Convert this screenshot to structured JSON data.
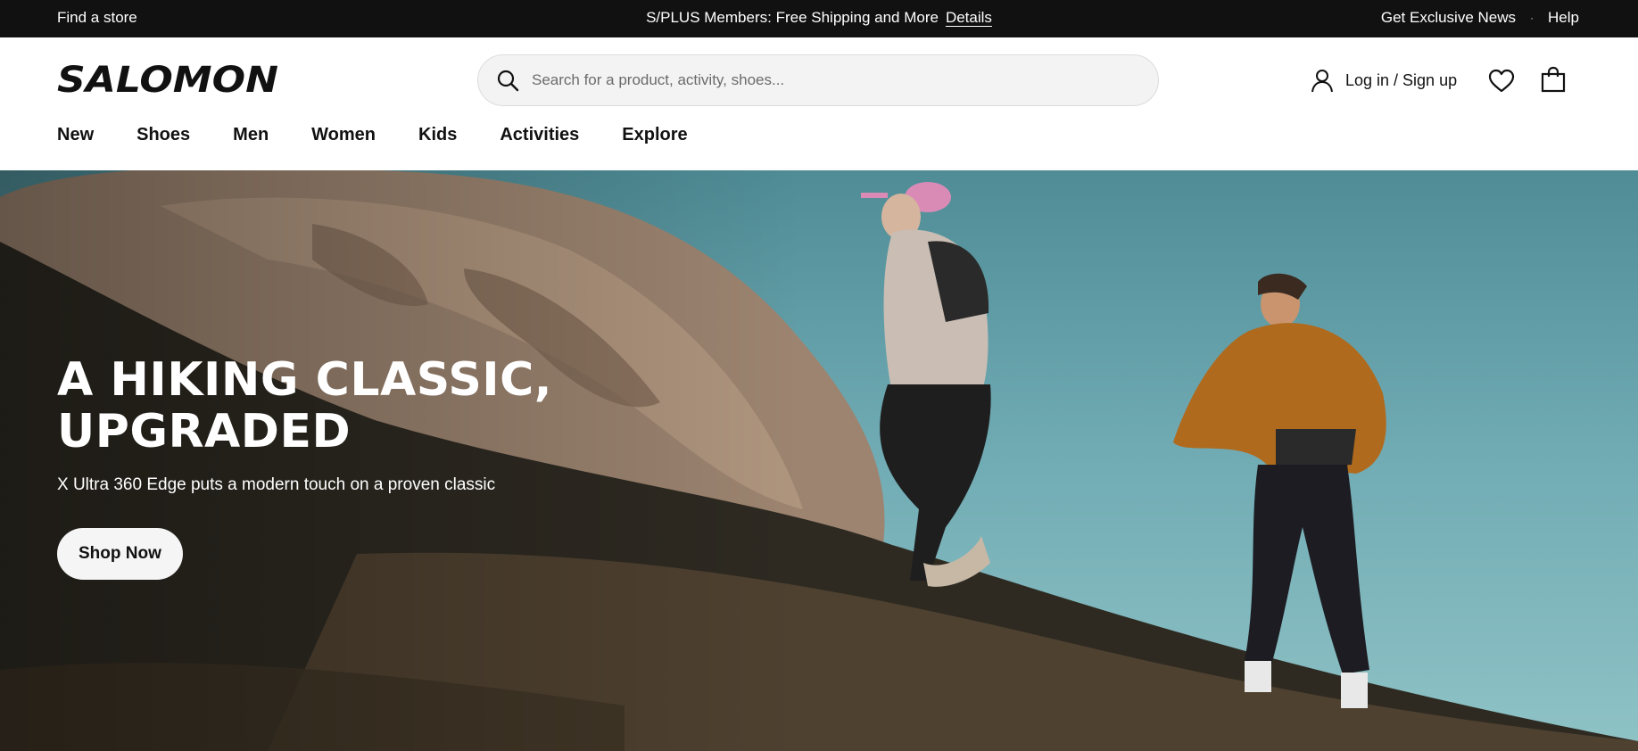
{
  "topbar": {
    "find_store": "Find a store",
    "promo_text": "S/PLUS Members: Free Shipping and More",
    "promo_link": "Details",
    "exclusive_news": "Get Exclusive News",
    "separator": "·",
    "help": "Help"
  },
  "header": {
    "logo_text": "SALOMON",
    "search_placeholder": "Search for a product, activity, shoes...",
    "account_label": "Log in / Sign up",
    "icons": [
      "search-icon",
      "user-icon",
      "heart-icon",
      "bag-icon"
    ]
  },
  "nav": {
    "items": [
      "New",
      "Shoes",
      "Men",
      "Women",
      "Kids",
      "Activities",
      "Explore"
    ]
  },
  "hero": {
    "title_line1": "A HIKING CLASSIC,",
    "title_line2": "UPGRADED",
    "subtitle": "X Ultra 360 Edge puts a modern touch on a proven classic",
    "cta": "Shop Now"
  },
  "colors": {
    "topbar_bg": "#111111",
    "sky": "#6ea9b2",
    "rock": "#a08670",
    "hillside": "#2e2a22",
    "jacket": "#b06a1e",
    "cap": "#d98bb6"
  }
}
